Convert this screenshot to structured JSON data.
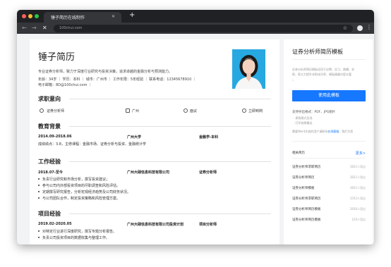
{
  "browser": {
    "tab_title": "锤子简历在线制作",
    "tab_close": "✕",
    "new_tab": "+",
    "url": "100chui.com",
    "traffic_colors": [
      "#ff5f57",
      "#febc2e",
      "#28c840"
    ]
  },
  "resume": {
    "name": "锤子简历",
    "summary": "专业证券分析师，致力于深度行业研究与投资决策，追求卓越的金融分析与预测能力。",
    "info": "年龄：34岁 ｜ 学历：本科 ｜ 城市：广州市 ｜ 工作年限：5年经验 ｜ 联系电话：12345678910 ｜",
    "email": "电子邮箱：8D@100chui.com ｜",
    "intent": {
      "title": "求职意向",
      "items": [
        "证券分析师",
        "广州",
        "面议",
        "立即到岗"
      ]
    },
    "education": {
      "title": "教育背景",
      "date": "2014.09-2018.06",
      "school": "广州大学",
      "major": "金融学-本科",
      "detail": "成绩绩点：3.8，主修课程：金融市场、证券分析与投资、金融统计学"
    },
    "work": {
      "title": "工作经验",
      "date": "2018.07-至今",
      "company": "广州大碌信息科技有限公司",
      "role": "证券分析师",
      "bullets": [
        "负责行业研究和市场分析，撰写投资建议；",
        "参与公司内外部投资项目的尽职调查和风险评估。",
        "定期撰写研究报告，分析宏观经济趋势及公司财务状况。",
        "与公司团队合作，制定投资策略和风险管理方案。"
      ]
    },
    "project": {
      "title": "项目经验",
      "date": "2019.02-2020.05",
      "company": "广州大碌信息科技有限公司投资计划",
      "role": "项目分析师",
      "bullets": [
        "对特定行业进行深度研究，撰写专题分析报告。",
        "负责公司投资项目的数据收集与整理工作。"
      ]
    }
  },
  "sidebar": {
    "title": "证券分析师简历模板",
    "desc": [
      "证券分析师简历模板适用于应聘、实习、跳槽、求",
      "职，帮大力提升求职成功率，模板精美内容丰富",
      "。"
    ],
    "use_button": "使用此模板",
    "formats_label": "支持导出格式：PDF、JPG图片",
    "bullet1": "· 原版格式呈现",
    "bullet2": "· 打印效果最佳",
    "hint_prefix": "需要Word文档的用户请联系",
    "hint_link": "在线客服",
    "hint_suffix": "，我们为您",
    "related_title": "相关简历",
    "more": "更多>",
    "related": [
      {
        "name": "证券分析师求职简历",
        "count": "3821人用过"
      },
      {
        "name": "证券分析师简历",
        "count": "3821人用过"
      },
      {
        "name": "证券分析师模板",
        "count": "3821人用过"
      },
      {
        "name": "证券分析师求职简历",
        "count": "3352人用过"
      },
      {
        "name": "证券分析师简历模板",
        "count": "2836人用过"
      },
      {
        "name": "证券分析师简历模板",
        "count": "126人用过"
      }
    ]
  }
}
